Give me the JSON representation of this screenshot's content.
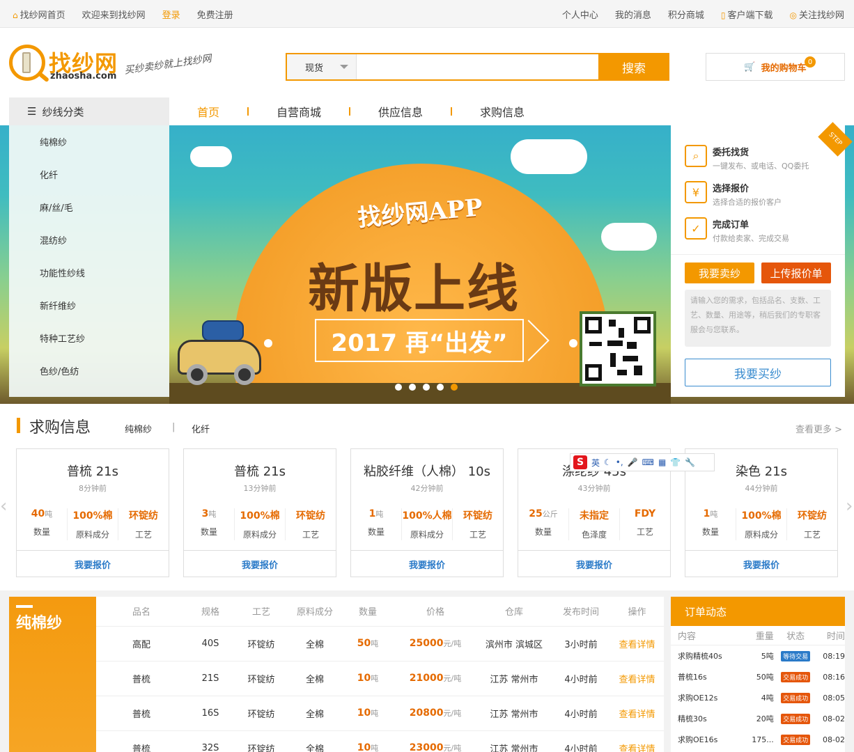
{
  "topbar": {
    "left": [
      "找纱网首页",
      "欢迎来到找纱网",
      "登录",
      "免费注册"
    ],
    "right": [
      "个人中心",
      "我的消息",
      "积分商城",
      "客户端下载",
      "关注找纱网"
    ]
  },
  "header": {
    "logo_text": "找纱网",
    "logo_sub": "zhaosha.com",
    "slogan": "买纱卖纱就上找纱网",
    "search_type": "现货",
    "search_placeholder": "",
    "search_button": "搜索",
    "cart_label": "我的购物车",
    "cart_count": "0"
  },
  "nav": {
    "category_label": "纱线分类",
    "items": [
      "首页",
      "自营商城",
      "供应信息",
      "求购信息"
    ]
  },
  "categories": [
    "纯棉纱",
    "化纤",
    "麻/丝/毛",
    "混纺纱",
    "功能性纱线",
    "新纤维纱",
    "特种工艺纱",
    "色纱/色纺"
  ],
  "banner": {
    "app_title": "找纱网APP",
    "main_title": "新版上线",
    "ribbon": "2017 再“出发”",
    "step_tag": "STEP",
    "active_dot": 4
  },
  "steps": [
    {
      "title": "委托找货",
      "desc": "一键发布、或电话、QQ委托",
      "icon": "search-doc-icon"
    },
    {
      "title": "选择报价",
      "desc": "选择合适的报价客户",
      "icon": "quote-icon"
    },
    {
      "title": "完成订单",
      "desc": "付款给卖家、完成交易",
      "icon": "checklist-icon"
    }
  ],
  "actions": {
    "sell": "我要卖纱",
    "upload": "上传报价单",
    "textarea": "请输入您的需求，包括品名、支数、工艺、数量、用途等，稍后我们的专职客服会与您联系。",
    "buy": "我要买纱"
  },
  "purchase": {
    "title": "求购信息",
    "tabs": [
      "纯棉纱",
      "化纤"
    ],
    "more": "查看更多 >",
    "cards": [
      {
        "name": "普梳 21s",
        "time": "8分钟前",
        "qty": "40",
        "unit": "吨",
        "mat": "100%棉",
        "mat_label": "原料成分",
        "craft": "环锭纺",
        "action": "我要报价"
      },
      {
        "name": "普梳 21s",
        "time": "13分钟前",
        "qty": "3",
        "unit": "吨",
        "mat": "100%棉",
        "mat_label": "原料成分",
        "craft": "环锭纺",
        "action": "我要报价"
      },
      {
        "name": "粘胶纤维（人棉） 10s",
        "time": "42分钟前",
        "qty": "1",
        "unit": "吨",
        "mat": "100%人棉",
        "mat_label": "原料成分",
        "craft": "环锭纺",
        "action": "我要报价"
      },
      {
        "name": "涤纶纱 45s",
        "time": "43分钟前",
        "qty": "25",
        "unit": "公斤",
        "mat": "未指定",
        "mat_label": "色泽度",
        "craft": "FDY",
        "action": "我要报价"
      },
      {
        "name": "染色 21s",
        "time": "44分钟前",
        "qty": "1",
        "unit": "吨",
        "mat": "100%棉",
        "mat_label": "原料成分",
        "craft": "环锭纺",
        "action": "我要报价"
      }
    ],
    "qty_label": "数量",
    "craft_label": "工艺"
  },
  "ime": {
    "lang": "英",
    "logo": "S"
  },
  "listing": {
    "tab": "纯棉纱",
    "headers": [
      "品名",
      "规格",
      "工艺",
      "原料成分",
      "数量",
      "价格",
      "仓库",
      "发布时间",
      "操作"
    ],
    "rows": [
      {
        "name": "高配",
        "spec": "40S",
        "craft": "环锭纺",
        "mat": "全棉",
        "qty": "50",
        "qty_unit": "吨",
        "price": "25000",
        "price_unit": "元/吨",
        "wh": "滨州市 滨城区",
        "time": "3小时前",
        "op": "查看详情"
      },
      {
        "name": "普梳",
        "spec": "21S",
        "craft": "环锭纺",
        "mat": "全棉",
        "qty": "10",
        "qty_unit": "吨",
        "price": "21000",
        "price_unit": "元/吨",
        "wh": "江苏 常州市",
        "time": "4小时前",
        "op": "查看详情"
      },
      {
        "name": "普梳",
        "spec": "16S",
        "craft": "环锭纺",
        "mat": "全棉",
        "qty": "10",
        "qty_unit": "吨",
        "price": "20800",
        "price_unit": "元/吨",
        "wh": "江苏 常州市",
        "time": "4小时前",
        "op": "查看详情"
      },
      {
        "name": "普梳",
        "spec": "32S",
        "craft": "环锭纺",
        "mat": "全棉",
        "qty": "10",
        "qty_unit": "吨",
        "price": "23000",
        "price_unit": "元/吨",
        "wh": "江苏 常州市",
        "time": "4小时前",
        "op": "查看详情"
      }
    ]
  },
  "orders": {
    "title": "订单动态",
    "headers": [
      "内容",
      "重量",
      "状态",
      "时间"
    ],
    "rows": [
      {
        "content": "求购精梳40s",
        "weight": "5吨",
        "status": "等待交易",
        "time": "08:19",
        "wait": true
      },
      {
        "content": "普梳16s",
        "weight": "50吨",
        "status": "交易成功",
        "time": "08:16",
        "wait": false
      },
      {
        "content": "求购OE12s",
        "weight": "4吨",
        "status": "交易成功",
        "time": "08:05",
        "wait": false
      },
      {
        "content": "精梳30s",
        "weight": "20吨",
        "status": "交易成功",
        "time": "08-02",
        "wait": false
      },
      {
        "content": "求购OE16s",
        "weight": "175...",
        "status": "交易成功",
        "time": "08-02",
        "wait": false
      }
    ]
  },
  "colors": {
    "accent": "#f39800",
    "link": "#2a7ac8",
    "price": "#e56a00"
  }
}
